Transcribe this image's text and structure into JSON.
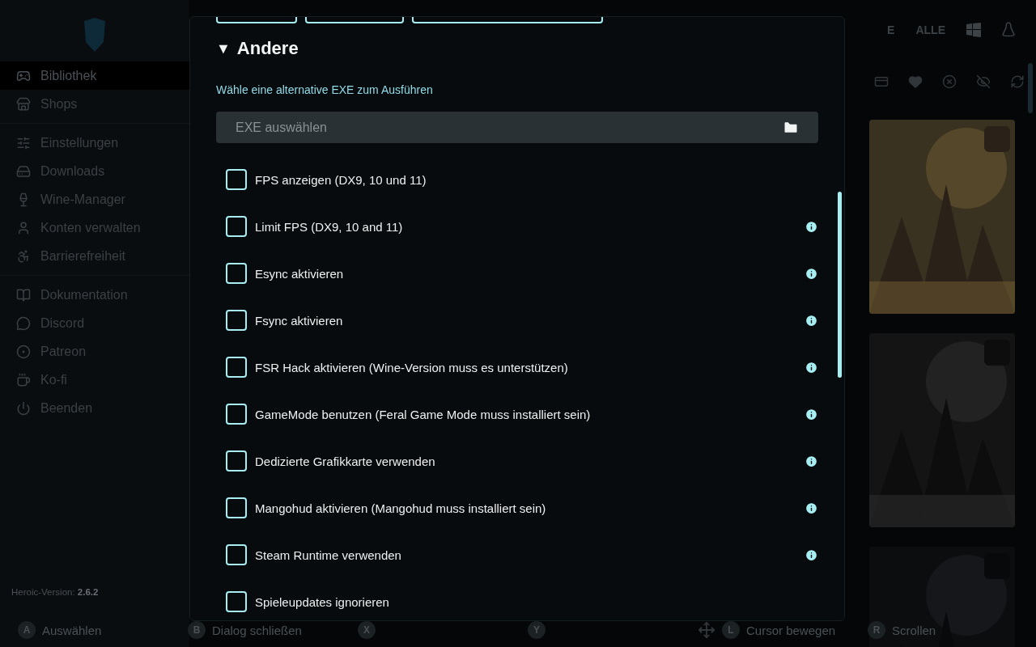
{
  "sidebar": {
    "groups": [
      [
        {
          "label": "Bibliothek",
          "selected": true
        },
        {
          "label": "Shops",
          "selected": false
        }
      ],
      [
        {
          "label": "Einstellungen",
          "selected": false
        },
        {
          "label": "Downloads",
          "selected": false
        },
        {
          "label": "Wine-Manager",
          "selected": false
        },
        {
          "label": "Konten verwalten",
          "selected": false
        },
        {
          "label": "Barrierefreiheit",
          "selected": false
        }
      ],
      [
        {
          "label": "Dokumentation",
          "selected": false
        },
        {
          "label": "Discord",
          "selected": false
        },
        {
          "label": "Patreon",
          "selected": false
        },
        {
          "label": "Ko-fi",
          "selected": false
        },
        {
          "label": "Beenden",
          "selected": false
        }
      ]
    ],
    "version": "Heroic-Version: **2.6.2**"
  },
  "library": {
    "filters": [
      "E",
      "ALLE"
    ],
    "covers": [
      {
        "kind": "picture"
      },
      {
        "kind": "picture"
      },
      {
        "kind": "picture"
      }
    ]
  },
  "dialog": {
    "section": {
      "title": "Andere",
      "expanded": true,
      "toggle": "▼"
    },
    "exe_label": "Wähle eine alternative EXE zum Ausführen",
    "exe_field": {
      "placeholder": "EXE auswählen"
    },
    "options": [
      {
        "label": "FPS anzeigen (DX9, 10 und 11)",
        "checked": false,
        "info": false
      },
      {
        "label": "Limit FPS (DX9, 10 and 11)",
        "checked": false,
        "info": true
      },
      {
        "label": "Esync aktivieren",
        "checked": false,
        "info": true
      },
      {
        "label": "Fsync aktivieren",
        "checked": false,
        "info": true
      },
      {
        "label": "FSR Hack aktivieren (Wine-Version muss es unterstützen)",
        "checked": false,
        "info": true
      },
      {
        "label": "GameMode benutzen (Feral Game Mode muss installiert sein)",
        "checked": false,
        "info": true
      },
      {
        "label": "Dedizierte Grafikkarte verwenden",
        "checked": false,
        "info": true
      },
      {
        "label": "Mangohud aktivieren (Mangohud muss installiert sein)",
        "checked": false,
        "info": true
      },
      {
        "label": "Steam Runtime verwenden",
        "checked": false,
        "info": true
      },
      {
        "label": "Spieleupdates ignorieren",
        "checked": false,
        "info": false
      }
    ]
  },
  "controller_hints": [
    {
      "key": "A",
      "label": "Auswählen",
      "dpad": false
    },
    {
      "key": "B",
      "label": "Dialog schließen",
      "dpad": false
    },
    {
      "key": "X",
      "dpad": false
    },
    {
      "key": "Y",
      "dpad": false
    },
    {
      "key": "L",
      "label": "Cursor bewegen",
      "dpad": true
    },
    {
      "key": "R",
      "label": "Scrollen",
      "dpad": false
    }
  ]
}
